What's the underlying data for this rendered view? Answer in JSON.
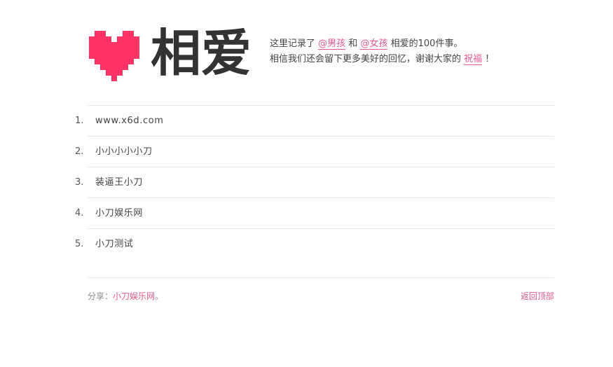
{
  "header": {
    "title": "相爱",
    "heart_color": "#ff3366",
    "intro": {
      "line1_prefix": "这里记录了",
      "boy_link": "@男孩",
      "connector": "和",
      "girl_link": "@女孩",
      "line1_suffix": "相爱的100件事。",
      "line2_prefix": "相信我们还会留下更多美好的回忆，谢谢大家的",
      "bless_link": "祝福",
      "line2_suffix": "！"
    }
  },
  "list": {
    "items": [
      {
        "number": "1.",
        "label": "www.x6d.com"
      },
      {
        "number": "2.",
        "label": "小小小小小刀"
      },
      {
        "number": "3.",
        "label": "装逼王小刀"
      },
      {
        "number": "4.",
        "label": "小刀娱乐网"
      },
      {
        "number": "5.",
        "label": "小刀测试"
      }
    ]
  },
  "footer": {
    "share_prefix": "分享：",
    "share_link": "小刀娱乐网",
    "share_suffix": "。",
    "back_to_top": "返回顶部"
  },
  "colors": {
    "accent": "#e5598f",
    "heart": "#ff3366",
    "text": "#444444",
    "divider": "#e6e6e6"
  }
}
